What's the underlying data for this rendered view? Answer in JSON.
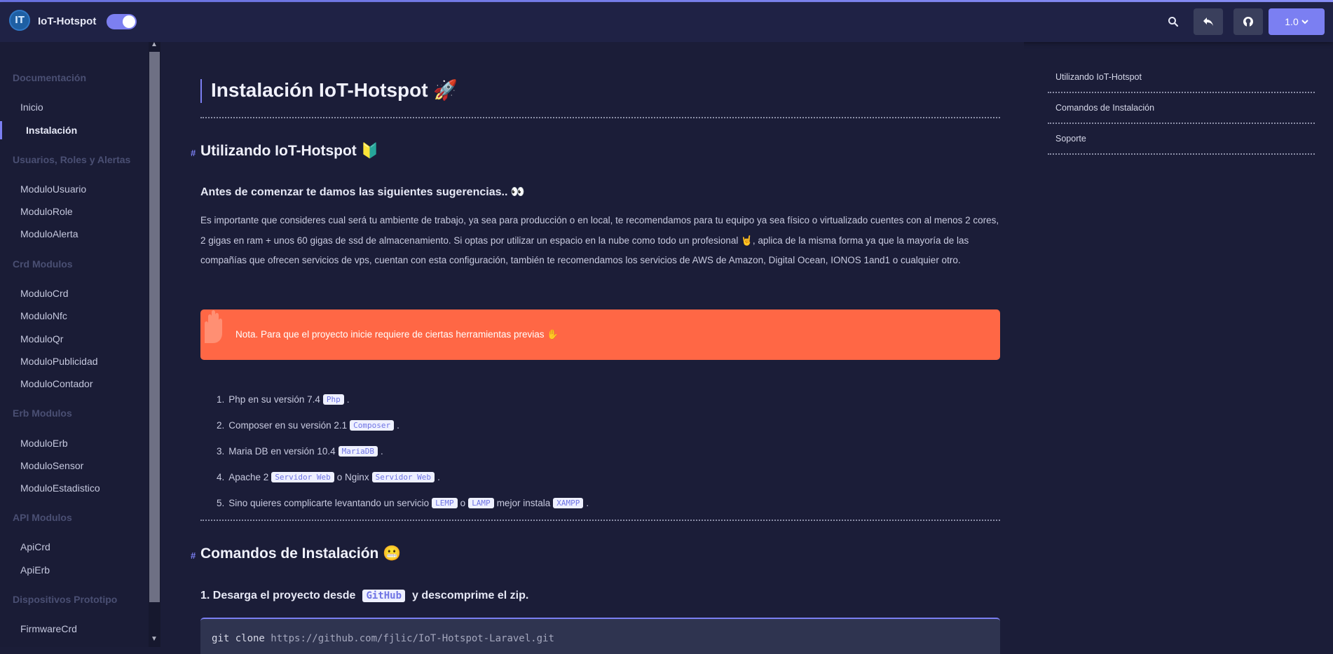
{
  "header": {
    "logo_text": "IT",
    "app_title": "IoT-Hotspot",
    "version_label": "1.0",
    "version_caret": "❯"
  },
  "sidebar": {
    "sections": [
      {
        "title": "Documentación",
        "items": [
          "Inicio",
          "Instalación"
        ]
      },
      {
        "title": "Usuarios, Roles y Alertas",
        "items": [
          "ModuloUsuario",
          "ModuloRole",
          "ModuloAlerta"
        ]
      },
      {
        "title": "Crd Modulos",
        "items": [
          "ModuloCrd",
          "ModuloNfc",
          "ModuloQr",
          "ModuloPublicidad",
          "ModuloContador"
        ]
      },
      {
        "title": "Erb Modulos",
        "items": [
          "ModuloErb",
          "ModuloSensor",
          "ModuloEstadistico"
        ]
      },
      {
        "title": "API Modulos",
        "items": [
          "ApiCrd",
          "ApiErb"
        ]
      },
      {
        "title": "Dispositivos Prototipo",
        "items": [
          "FirmwareCrd"
        ]
      }
    ],
    "active": "Instalación"
  },
  "content": {
    "title": "Instalación IoT-Hotspot 🚀",
    "section1": {
      "hash": "#",
      "heading": "Utilizando IoT-Hotspot 🔰",
      "subheading": "Antes de comenzar te damos las siguientes sugerencias.. 👀",
      "paragraph": "Es importante que consideres cual será tu ambiente de trabajo, ya sea para producción o en local, te recomendamos para tu equipo ya sea físico o virtualizado cuentes con al menos 2 cores, 2 gigas en ram + unos 60 gigas de ssd de almacenamiento. Si optas por utilizar un espacio en la nube como todo un profesional 🤘, aplica de la misma forma ya que la mayoría de las compañías que ofrecen servicios de vps, cuentan con esta configuración, también te recomendamos los servicios de AWS de Amazon, Digital Ocean, IONOS 1and1 o cualquier otro.",
      "note": "Nota. Para que el proyecto inicie requiere de ciertas herramientas previas ✋",
      "list": [
        {
          "num": "1.",
          "text": "Php en su versión 7.4",
          "codes": [
            "Php"
          ],
          "suffix": "."
        },
        {
          "num": "2.",
          "text": "Composer en su versión 2.1",
          "codes": [
            "Composer"
          ],
          "suffix": "."
        },
        {
          "num": "3.",
          "text": "Maria DB en versión 10.4",
          "codes": [
            "MariaDB"
          ],
          "suffix": "."
        },
        {
          "num": "4.",
          "text": "Apache 2",
          "codes": [
            "Servidor Web"
          ],
          "mid": "o Nginx",
          "codes2": [
            "Servidor Web"
          ],
          "suffix": "."
        },
        {
          "num": "5.",
          "text": "Sino quieres complicarte levantando un servicio",
          "codes": [
            "LEMP"
          ],
          "mid": "o",
          "codes2": [
            "LAMP"
          ],
          "mid2": "mejor instala",
          "codes3": [
            "XAMPP"
          ],
          "suffix": "."
        }
      ]
    },
    "section2": {
      "hash": "#",
      "heading": "Comandos de Instalación 😬",
      "step1_prefix": "1. Desarga el proyecto desde",
      "step1_code": "GitHub",
      "step1_suffix": "y descomprime el zip.",
      "code_cmd": "git clone ",
      "code_url": "https://github.com/fjlic/IoT-Hotspot-Laravel.git"
    }
  },
  "toc": [
    "Utilizando IoT-Hotspot",
    "Comandos de Instalación",
    "Soporte"
  ]
}
